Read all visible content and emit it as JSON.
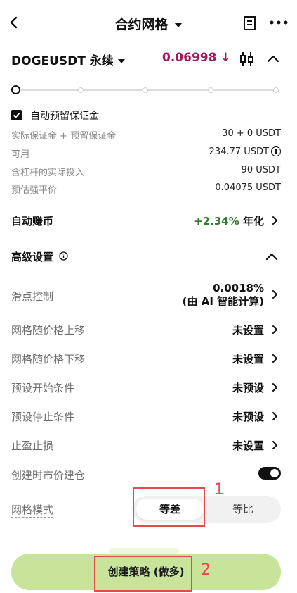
{
  "header": {
    "title": "合约网格"
  },
  "pair": {
    "name": "DOGEUSDT 永续",
    "price": "0.06998 ↓"
  },
  "slider": {
    "value_fraction": 0,
    "stops": 5
  },
  "margin": {
    "checkbox_label": "自动预留保证金",
    "checked": true,
    "rows": [
      {
        "label": "实际保证金 + 预留保证金",
        "value": "30 + 0 USDT"
      },
      {
        "label": "可用",
        "value": "234.77 USDT"
      },
      {
        "label": "含杠杆的实际投入",
        "value": "90 USDT"
      },
      {
        "label": "预估强平价",
        "value": "0.04075 USDT"
      }
    ]
  },
  "auto_earn": {
    "label": "自动赚币",
    "pct": "+2.34%",
    "suffix": "年化"
  },
  "advanced": {
    "title": "高级设置",
    "slippage": {
      "label": "滑点控制",
      "value": "0.0018%",
      "note": "(由 AI 智能计算)"
    },
    "rows": [
      {
        "label": "网格随价格上移",
        "value": "未设置"
      },
      {
        "label": "网格随价格下移",
        "value": "未设置"
      },
      {
        "label": "预设开始条件",
        "value": "未预设"
      },
      {
        "label": "预设停止条件",
        "value": "未预设"
      },
      {
        "label": "止盈止损",
        "value": "未设置"
      }
    ],
    "market_open": {
      "label": "创建时市价建仓",
      "on": true
    },
    "grid_mode": {
      "label": "网格模式",
      "options": [
        "等差",
        "等比"
      ],
      "selected": "等差"
    }
  },
  "cta": {
    "label": "创建策略 (做多)"
  },
  "annotations": [
    "1",
    "2"
  ],
  "colors": {
    "price_down": "#a3195b",
    "earn_green": "#2e7d32",
    "cta_bg": "#c8e49a",
    "annotation_red": "#e5484d"
  }
}
